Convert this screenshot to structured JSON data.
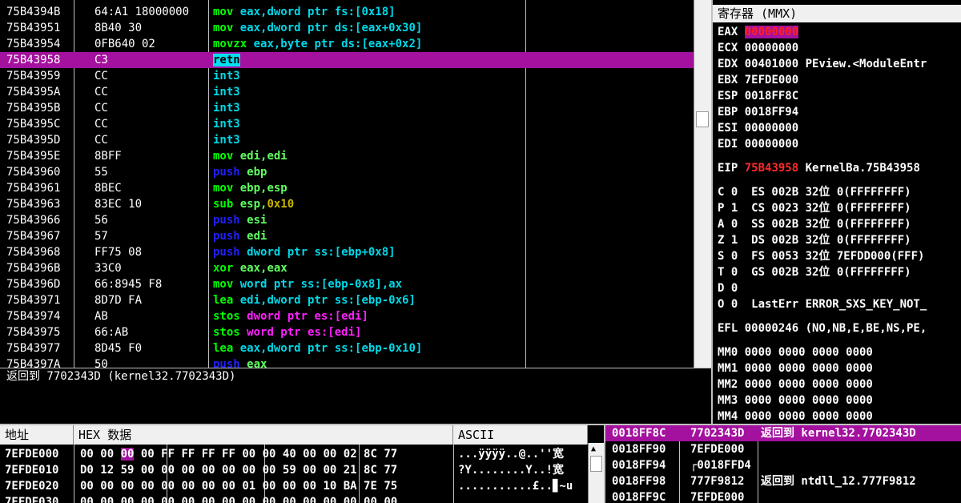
{
  "colors": {
    "mnemonic_green": "#00ff00",
    "mnemonic_blue": "#2020ff",
    "mnemonic_magenta": "#ff20ff",
    "mnemonic_cyan": "#00d8e8",
    "operand_cyan": "#00d8e8",
    "operand_lightgreen": "#60ff60",
    "immediate": "#c8b400",
    "selection": "#a3119e"
  },
  "cpu": {
    "rows": [
      {
        "addr": "75B4394B",
        "hex": "64:A1 18000000",
        "mn": "mov",
        "op": "eax,dword ptr fs:[0x18]",
        "mnc": "green",
        "opc": "cyan"
      },
      {
        "addr": "75B43951",
        "hex": "8B40 30",
        "mn": "mov",
        "op": "eax,dword ptr ds:[eax+0x30]",
        "mnc": "green",
        "opc": "cyan"
      },
      {
        "addr": "75B43954",
        "hex": "0FB640 02",
        "mn": "movzx",
        "op": "eax,byte ptr ds:[eax+0x2]",
        "mnc": "green",
        "opc": "cyan"
      },
      {
        "addr": "75B43958",
        "hex": "C3",
        "mn": "retn",
        "op": "",
        "mnc": "ret",
        "opc": "cyan",
        "selected": true
      },
      {
        "addr": "75B43959",
        "hex": "CC",
        "mn": "int3",
        "op": "",
        "mnc": "cyan",
        "opc": "cyan"
      },
      {
        "addr": "75B4395A",
        "hex": "CC",
        "mn": "int3",
        "op": "",
        "mnc": "cyan",
        "opc": "cyan"
      },
      {
        "addr": "75B4395B",
        "hex": "CC",
        "mn": "int3",
        "op": "",
        "mnc": "cyan",
        "opc": "cyan"
      },
      {
        "addr": "75B4395C",
        "hex": "CC",
        "mn": "int3",
        "op": "",
        "mnc": "cyan",
        "opc": "cyan"
      },
      {
        "addr": "75B4395D",
        "hex": "CC",
        "mn": "int3",
        "op": "",
        "mnc": "cyan",
        "opc": "cyan"
      },
      {
        "addr": "75B4395E",
        "hex": "8BFF",
        "mn": "mov",
        "op": "edi,edi",
        "mnc": "green",
        "opc": "lightgreen"
      },
      {
        "addr": "75B43960",
        "hex": "55",
        "mn": "push",
        "op": "ebp",
        "mnc": "blue",
        "opc": "lightgreen"
      },
      {
        "addr": "75B43961",
        "hex": "8BEC",
        "mn": "mov",
        "op": "ebp,esp",
        "mnc": "green",
        "opc": "lightgreen"
      },
      {
        "addr": "75B43963",
        "hex": "83EC 10",
        "mn": "sub",
        "op": "esp,0x10",
        "mnc": "green",
        "opc": "imm"
      },
      {
        "addr": "75B43966",
        "hex": "56",
        "mn": "push",
        "op": "esi",
        "mnc": "blue",
        "opc": "lightgreen"
      },
      {
        "addr": "75B43967",
        "hex": "57",
        "mn": "push",
        "op": "edi",
        "mnc": "blue",
        "opc": "lightgreen"
      },
      {
        "addr": "75B43968",
        "hex": "FF75 08",
        "mn": "push",
        "op": "dword ptr ss:[ebp+0x8]",
        "mnc": "blue",
        "opc": "cyan"
      },
      {
        "addr": "75B4396B",
        "hex": "33C0",
        "mn": "xor",
        "op": "eax,eax",
        "mnc": "green",
        "opc": "lightgreen"
      },
      {
        "addr": "75B4396D",
        "hex": "66:8945 F8",
        "mn": "mov",
        "op": "word ptr ss:[ebp-0x8],ax",
        "mnc": "green",
        "opc": "cyan"
      },
      {
        "addr": "75B43971",
        "hex": "8D7D FA",
        "mn": "lea",
        "op": "edi,dword ptr ss:[ebp-0x6]",
        "mnc": "green",
        "opc": "cyan"
      },
      {
        "addr": "75B43974",
        "hex": "AB",
        "mn": "stos",
        "op": "dword ptr es:[edi]",
        "mnc": "green",
        "opc": "magenta"
      },
      {
        "addr": "75B43975",
        "hex": "66:AB",
        "mn": "stos",
        "op": "word ptr es:[edi]",
        "mnc": "green",
        "opc": "magenta"
      },
      {
        "addr": "75B43977",
        "hex": "8D45 F0",
        "mn": "lea",
        "op": "eax,dword ptr ss:[ebp-0x10]",
        "mnc": "green",
        "opc": "cyan"
      },
      {
        "addr": "75B4397A",
        "hex": "50",
        "mn": "push",
        "op": "eax",
        "mnc": "blue",
        "opc": "lightgreen"
      }
    ]
  },
  "info": {
    "text": "返回到 7702343D (kernel32.7702343D)"
  },
  "regs": {
    "title": "寄存器 (MMX)",
    "gp": [
      {
        "name": "EAX",
        "val": "00000000",
        "extra": "",
        "hl": true
      },
      {
        "name": "ECX",
        "val": "00000000",
        "extra": ""
      },
      {
        "name": "EDX",
        "val": "00401000",
        "extra": "PEview.<ModuleEntr"
      },
      {
        "name": "EBX",
        "val": "7EFDE000",
        "extra": ""
      },
      {
        "name": "ESP",
        "val": "0018FF8C",
        "extra": ""
      },
      {
        "name": "EBP",
        "val": "0018FF94",
        "extra": ""
      },
      {
        "name": "ESI",
        "val": "00000000",
        "extra": ""
      },
      {
        "name": "EDI",
        "val": "00000000",
        "extra": ""
      }
    ],
    "eip": {
      "name": "EIP",
      "val": "75B43958",
      "extra": "KernelBa.75B43958"
    },
    "flags": [
      "C 0  ES 002B 32位 0(FFFFFFFF)",
      "P 1  CS 0023 32位 0(FFFFFFFF)",
      "A 0  SS 002B 32位 0(FFFFFFFF)",
      "Z 1  DS 002B 32位 0(FFFFFFFF)",
      "S 0  FS 0053 32位 7EFDD000(FFF)",
      "T 0  GS 002B 32位 0(FFFFFFFF)",
      "D 0",
      "O 0  LastErr ERROR_SXS_KEY_NOT_"
    ],
    "efl": "EFL 00000246 (NO,NB,E,BE,NS,PE,",
    "mmx": [
      "MM0 0000 0000 0000 0000",
      "MM1 0000 0000 0000 0000",
      "MM2 0000 0000 0000 0000",
      "MM3 0000 0000 0000 0000",
      "MM4 0000 0000 0000 0000"
    ]
  },
  "dump": {
    "hdr_addr": "地址",
    "hdr_hex": "HEX 数据",
    "hdr_ascii": "ASCII",
    "rows": [
      {
        "addr": "7EFDE000",
        "g1a": "00 00 ",
        "sel": "00",
        "g1b": " 00",
        "g2": "FF FF FF FF",
        "g3": "00 00 40 00",
        "g4": "00 02 8C 77",
        "ascii": "...ÿÿÿÿ..@..''宽"
      },
      {
        "addr": "7EFDE010",
        "g1a": "D0 12 59 00",
        "sel": "",
        "g1b": "",
        "g2": "00 00 00 00",
        "g3": "00 00 59 00",
        "g4": "00 21 8C 77",
        "ascii": "?Y........Y..!宽"
      },
      {
        "addr": "7EFDE020",
        "g1a": "00 00 00 00",
        "sel": "",
        "g1b": "",
        "g2": "00 00 00 00",
        "g3": "01 00 00 00",
        "g4": "10 BA 7E 75",
        "ascii": "...........£..▊~u"
      },
      {
        "addr": "7EFDE030",
        "g1a": "00 00 00 00",
        "sel": "",
        "g1b": "",
        "g2": "00 00 00 00",
        "g3": "00 00 00 00",
        "g4": "00 00 00 00",
        "ascii": "................"
      }
    ]
  },
  "stack": {
    "rows": [
      {
        "addr": "0018FF8C",
        "val": "7702343D",
        "cmt": "返回到 kernel32.7702343D",
        "selected": true
      },
      {
        "addr": "0018FF90",
        "val": "7EFDE000",
        "cmt": ""
      },
      {
        "addr": "0018FF94",
        "val": "┌0018FFD4",
        "cmt": ""
      },
      {
        "addr": "0018FF98",
        "val": "777F9812",
        "cmt": "返回到 ntdll_12.777F9812"
      },
      {
        "addr": "0018FF9C",
        "val": "7EFDE000",
        "cmt": ""
      }
    ]
  }
}
